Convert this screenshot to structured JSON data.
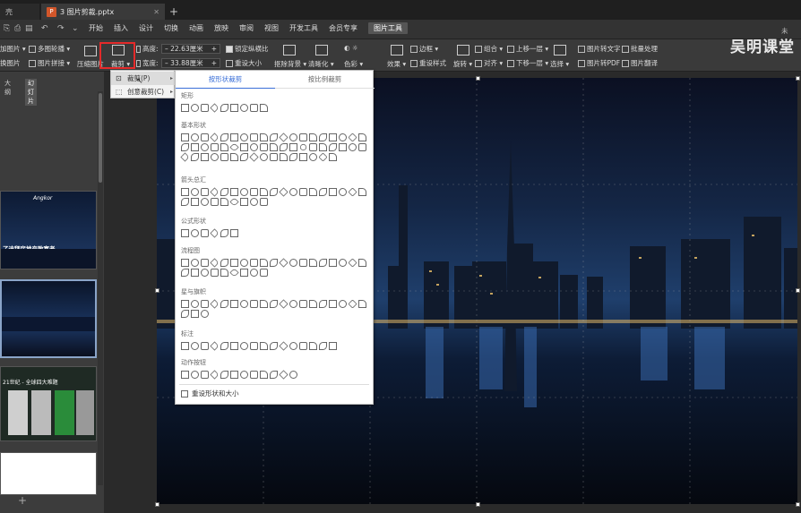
{
  "titlebar": {
    "tab1_label": "壳",
    "tab2_label": "3 图片剪裁.pptx",
    "tab2_badge": "P",
    "plus": "+"
  },
  "menubar": {
    "items": [
      "开始",
      "插入",
      "设计",
      "切换",
      "动画",
      "放映",
      "审阅",
      "视图",
      "开发工具",
      "会员专享",
      "图片工具"
    ],
    "active": "图片工具"
  },
  "ribbon": {
    "add_picture": "加图片 ▾",
    "multi_outline": "多图轮播 ▾",
    "swap_picture": "换图片",
    "picture_collage": "图片拼接 ▾",
    "compress": "压缩图片",
    "crop": "裁剪 ▾",
    "height_label": "高度:",
    "height_value": "22.63厘米",
    "width_label": "宽度:",
    "width_value": "33.88厘米",
    "lock_ratio": "锁定纵横比",
    "reset_size": "重设大小",
    "remove_bg": "抠除背景 ▾",
    "sharpen": "清晰化 ▾",
    "color": "色彩 ▾",
    "effects": "效果 ▾",
    "border": "边框 ▾",
    "reset_style": "重设样式",
    "rotate": "旋转 ▾",
    "group": "组合 ▾",
    "align": "对齐 ▾",
    "bring_forward": "上移一层 ▾",
    "send_backward": "下移一层 ▾",
    "select": "选择 ▾",
    "pic_to_text": "图片转文字",
    "batch": "批量处理",
    "pic_to_pdf": "图片转PDF",
    "flip": "图片翻译",
    "unknown_right": "未"
  },
  "watermark": "吴明课堂",
  "pane": {
    "tab_outline": "大纲",
    "tab_slides": "幻灯片",
    "thumb1_title": "Angkor",
    "thumb1_text": "了迪拜房地产致富者",
    "thumb3_text": "21世纪 - 全球四大难题",
    "add": "+"
  },
  "crop_menu": {
    "items": [
      {
        "label": "裁剪(P)",
        "arrow": "▸"
      },
      {
        "label": "创意裁剪(C)",
        "arrow": "▸"
      }
    ]
  },
  "shapes_panel": {
    "tab_shape": "按形状裁剪",
    "tab_ratio": "按比例裁剪",
    "categories": [
      "矩形",
      "基本形状",
      "箭头总汇",
      "公式形状",
      "流程图",
      "星与旗帜",
      "标注",
      "动作按钮"
    ],
    "reset": "重设形状和大小"
  },
  "colors": {
    "accent": "#3a6fd8",
    "highlight": "#e52a2a"
  }
}
